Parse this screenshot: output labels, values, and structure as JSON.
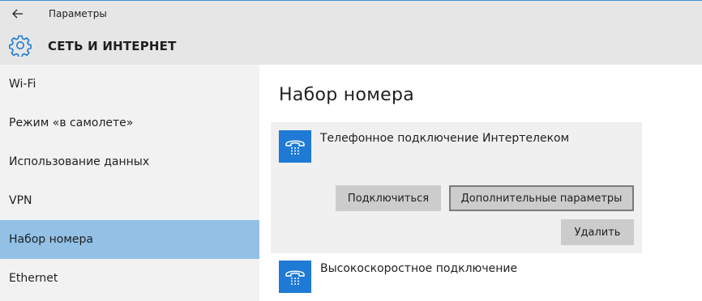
{
  "titlebar": {
    "back_icon": "back-arrow-icon",
    "title": "Параметры"
  },
  "header": {
    "icon": "gear-icon",
    "title": "СЕТЬ И ИНТЕРНЕТ",
    "accent_color": "#1e7ad4"
  },
  "sidebar": {
    "selected_color": "#93c1e6",
    "items": [
      {
        "label": "Wi-Fi"
      },
      {
        "label": "Режим «в самолете»"
      },
      {
        "label": "Использование данных"
      },
      {
        "label": "VPN"
      },
      {
        "label": "Набор номера",
        "selected": true
      },
      {
        "label": "Ethernet"
      }
    ]
  },
  "main": {
    "title": "Набор номера",
    "connections": [
      {
        "name": "Телефонное подключение Интертелеком",
        "icon": "dialup-phone-icon",
        "expanded": true,
        "buttons": {
          "connect": "Подключиться",
          "advanced": "Дополнительные параметры",
          "delete": "Удалить"
        }
      },
      {
        "name": "Высокоскоростное подключение",
        "icon": "dialup-phone-icon",
        "expanded": false
      }
    ]
  }
}
